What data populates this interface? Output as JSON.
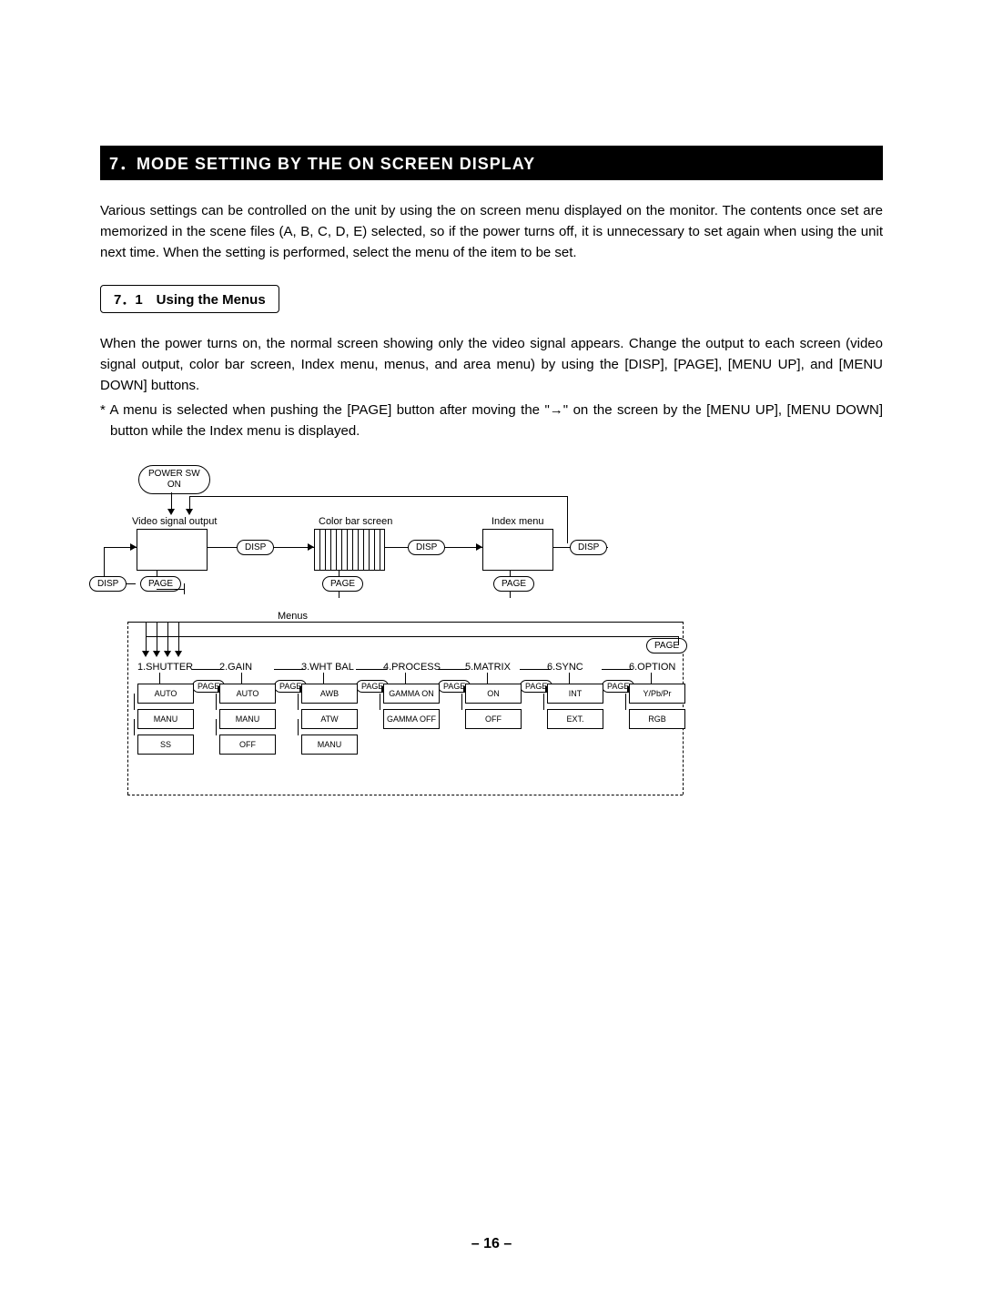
{
  "section_title": "7．MODE SETTING BY THE ON SCREEN DISPLAY",
  "para1": "Various settings can be controlled on the unit by using the on screen menu displayed on the monitor. The contents once set are memorized in the scene files (A, B, C, D, E) selected, so if the power turns off, it is unnecessary to set again when using the unit next time. When the setting is performed, select the menu of the item to be set.",
  "subhead": "7．1　Using the Menus",
  "para2": "When the power turns on, the normal screen showing only the video signal appears. Change the output to each screen (video signal output, color bar screen, Index menu, menus, and area menu) by using the [DISP], [PAGE], [MENU UP], and [MENU DOWN] buttons.",
  "footnote": "* A menu is selected when pushing the [PAGE] button after moving the \"→\" on the screen by the [MENU UP], [MENU DOWN] button while the Index menu is displayed.",
  "page_number": "– 16 –",
  "diagram": {
    "power_sw": "POWER SW\nON",
    "top_labels": [
      "Video signal output",
      "Color bar screen",
      "Index menu"
    ],
    "disp": "DISP",
    "page": "PAGE",
    "menus_label": "Menus",
    "menu_headers": [
      "1.SHUTTER",
      "2.GAIN",
      "3.WHT BAL",
      "4.PROCESS",
      "5.MATRIX",
      "6.SYNC",
      "6.OPTION"
    ],
    "menu_cols": [
      [
        "AUTO",
        "MANU",
        "SS"
      ],
      [
        "AUTO",
        "MANU",
        "OFF"
      ],
      [
        "AWB",
        "ATW",
        "MANU"
      ],
      [
        "GAMMA ON",
        "GAMMA OFF"
      ],
      [
        "ON",
        "OFF"
      ],
      [
        "INT",
        "EXT."
      ],
      [
        "Y/Pb/Pr",
        "RGB"
      ]
    ]
  }
}
